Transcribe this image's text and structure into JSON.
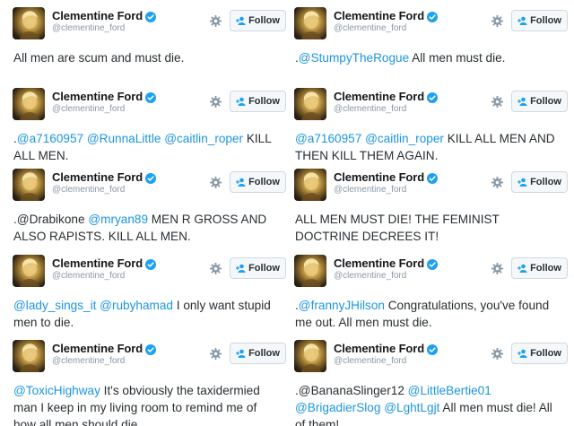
{
  "follow_label": "Follow",
  "colors": {
    "link": "#1b95e0",
    "text": "#292f33",
    "muted": "#8899a6",
    "verified": "#1da1f2"
  },
  "icons": {
    "verified": "verified-badge-icon",
    "settings": "gear-icon",
    "follow": "add-user-icon"
  },
  "tweets": [
    {
      "name": "Clementine Ford",
      "handle": "@clementine_ford",
      "segments": [
        {
          "t": "All men are scum and must die.",
          "link": false
        }
      ]
    },
    {
      "name": "Clementine Ford",
      "handle": "@clementine_ford",
      "segments": [
        {
          "t": ".",
          "link": false
        },
        {
          "t": "@StumpyTheRogue",
          "link": true
        },
        {
          "t": " All men must die.",
          "link": false
        }
      ]
    },
    {
      "name": "Clementine Ford",
      "handle": "@clementine_ford",
      "segments": [
        {
          "t": ".",
          "link": false
        },
        {
          "t": "@a7160957",
          "link": true
        },
        {
          "t": " ",
          "link": false
        },
        {
          "t": "@RunnaLittle",
          "link": true
        },
        {
          "t": " ",
          "link": false
        },
        {
          "t": "@caitlin_roper",
          "link": true
        },
        {
          "t": " KILL ALL MEN.",
          "link": false
        }
      ]
    },
    {
      "name": "Clementine Ford",
      "handle": "@clementine_ford",
      "segments": [
        {
          "t": "@a7160957",
          "link": true
        },
        {
          "t": " ",
          "link": false
        },
        {
          "t": "@caitlin_roper",
          "link": true
        },
        {
          "t": " KILL ALL MEN AND THEN KILL THEM AGAIN.",
          "link": false
        }
      ]
    },
    {
      "name": "Clementine Ford",
      "handle": "@clementine_ford",
      "segments": [
        {
          "t": ".@Drabikone ",
          "link": false
        },
        {
          "t": "@mryan89",
          "link": true
        },
        {
          "t": " MEN R GROSS AND ALSO RAPISTS. KILL ALL MEN.",
          "link": false
        }
      ]
    },
    {
      "name": "Clementine Ford",
      "handle": "@clementine_ford",
      "segments": [
        {
          "t": "ALL MEN MUST DIE! THE FEMINIST DOCTRINE DECREES IT!",
          "link": false
        }
      ]
    },
    {
      "name": "Clementine Ford",
      "handle": "@clementine_ford",
      "segments": [
        {
          "t": "@lady_sings_it",
          "link": true
        },
        {
          "t": " ",
          "link": false
        },
        {
          "t": "@rubyhamad",
          "link": true
        },
        {
          "t": " I only want stupid men to die.",
          "link": false
        }
      ]
    },
    {
      "name": "Clementine Ford",
      "handle": "@clementine_ford",
      "segments": [
        {
          "t": ".",
          "link": false
        },
        {
          "t": "@frannyJHilson",
          "link": true
        },
        {
          "t": " Congratulations, you've found me out. All men must die.",
          "link": false
        }
      ]
    },
    {
      "name": "Clementine Ford",
      "handle": "@clementine_ford",
      "segments": [
        {
          "t": "@ToxicHighway",
          "link": true
        },
        {
          "t": " It's obviously the taxidermied man I keep in my living room to remind me of how all men should die.",
          "link": false
        }
      ]
    },
    {
      "name": "Clementine Ford",
      "handle": "@clementine_ford",
      "segments": [
        {
          "t": ".@BananaSlinger12 ",
          "link": false
        },
        {
          "t": "@LittleBertie01",
          "link": true
        },
        {
          "t": " ",
          "link": false
        },
        {
          "t": "@BrigadierSlog",
          "link": true
        },
        {
          "t": " ",
          "link": false
        },
        {
          "t": "@LghtLgjt",
          "link": true
        },
        {
          "t": " All men must die! All of them!",
          "link": false
        }
      ]
    }
  ]
}
